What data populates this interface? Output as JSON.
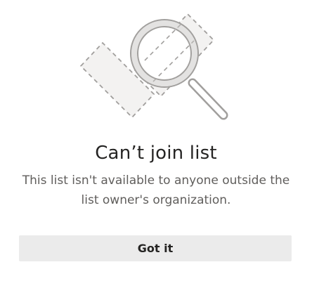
{
  "dialog": {
    "title": "Can’t join list",
    "message": "This list isn't available to anyone outside the list owner's organization.",
    "button_label": "Got it",
    "illustration_icon": "magnifier-broken-checkmark-icon"
  },
  "colors": {
    "title": "#252423",
    "message": "#605e5c",
    "button_bg": "#ebebeb",
    "illustration_stroke": "#a19f9d",
    "illustration_fill": "#f3f2f1"
  }
}
